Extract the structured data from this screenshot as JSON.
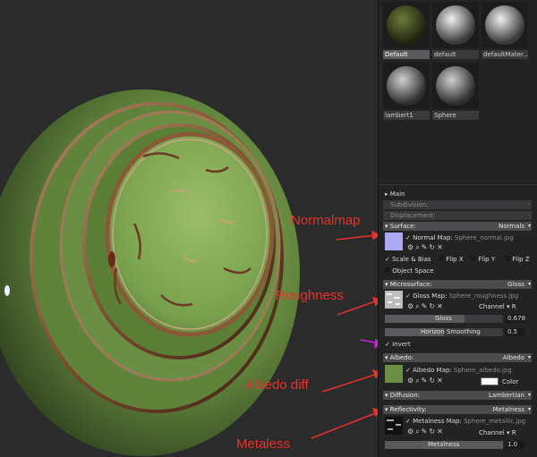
{
  "annotations": {
    "normalmap": "Normalmap",
    "roughness": "Roughness",
    "albedo_diff": "Albedo diff",
    "metaless": "Metaless"
  },
  "materials": [
    {
      "label": "Default",
      "selected": true
    },
    {
      "label": "default",
      "selected": false
    },
    {
      "label": "defaultMater...",
      "selected": false
    },
    {
      "label": "lambert1",
      "selected": false
    },
    {
      "label": "Sphere",
      "selected": false
    }
  ],
  "sections": {
    "main": "Main",
    "subdivision": "Subdivision:",
    "displacement": "Displacement:",
    "surface": {
      "label": "Surface:",
      "value": "Normals"
    },
    "microsurface": {
      "label": "Microsurface:",
      "value": "Gloss"
    },
    "albedo": {
      "label": "Albedo:",
      "value": "Albedo"
    },
    "diffusion": {
      "label": "Diffusion:",
      "value": "Lambertian"
    },
    "reflectivity": {
      "label": "Reflectivity:",
      "value": "Metalness"
    }
  },
  "surface": {
    "map_label": "Normal Map:",
    "map_file": "Sphere_normal.jpg",
    "scale_bias": "Scale & Bias",
    "flip_x": "Flip X",
    "flip_y": "Flip Y",
    "flip_z": "Flip Z",
    "object_space": "Object Space"
  },
  "microsurface": {
    "map_label": "Gloss Map:",
    "map_file": "Sphere_roughness.jpg",
    "channel_label": "Channel",
    "channel_value": "R",
    "gloss_label": "Gloss",
    "gloss_value": "0.678",
    "horizon_label": "Horizon Smoothing",
    "horizon_value": "0.5",
    "invert": "Invert"
  },
  "albedo": {
    "map_label": "Albedo Map:",
    "map_file": "Sphere_albedo.jpg",
    "color_label": "Color"
  },
  "reflectivity": {
    "map_label": "Metalness Map:",
    "map_file": "Sphere_metallic.jpg",
    "channel_label": "Channel",
    "channel_value": "R",
    "metalness_label": "Metalness",
    "metalness_value": "1.0"
  },
  "checkmark": "✓",
  "dropdown_arrow": "▾",
  "collapse_arrow": "▾",
  "expand_arrow": "▸",
  "dash": "-",
  "colors": {
    "accent_red": "#e6322b",
    "arrow_magenta": "#d21ee6",
    "sphere_green": "#6b8f45"
  }
}
